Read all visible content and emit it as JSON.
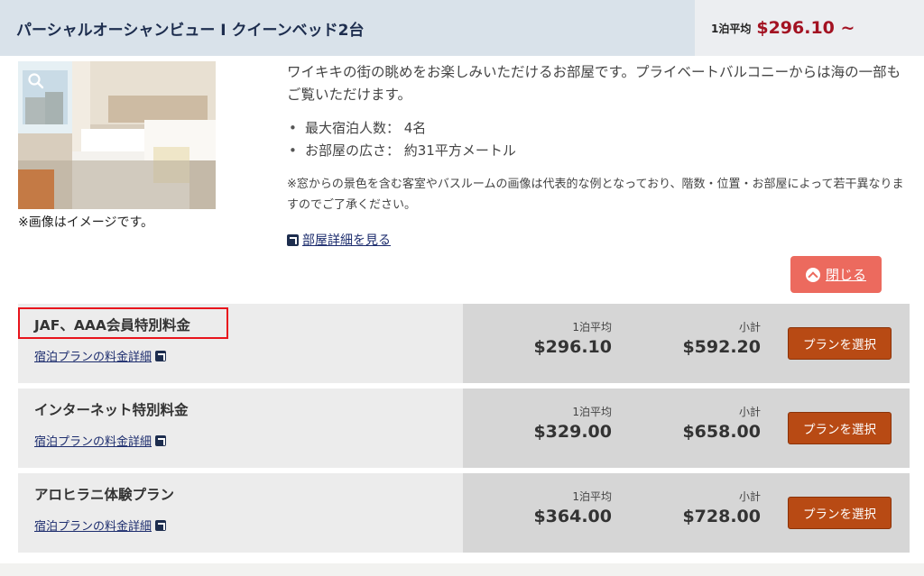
{
  "room": {
    "title": "パーシャルオーシャンビュー I クイーンベッド2台",
    "avg_label": "1泊平均",
    "avg_price": "$296.10 ~",
    "photo_note": "※画像はイメージです。",
    "description": "ワイキキの街の眺めをお楽しみいただけるお部屋です。プライベートバルコニーからは海の一部もご覧いただけます。",
    "specs": [
      "最大宿泊人数： 4名",
      "お部屋の広さ： 約31平方メートル"
    ],
    "note": "※窓からの景色を含む客室やバスルームの画像は代表的な例となっており、階数・位置・お部屋によって若干異なりますのでご了承ください。",
    "detail_link": "部屋詳細を見る",
    "close_label": "閉じる"
  },
  "plans": [
    {
      "name": "JAF、AAA会員特別料金",
      "link": "宿泊プランの料金詳細",
      "avg_label": "1泊平均",
      "avg": "$296.10",
      "subtotal_label": "小計",
      "subtotal": "$592.20",
      "button": "プランを選択",
      "highlighted": true
    },
    {
      "name": "インターネット特別料金",
      "link": "宿泊プランの料金詳細",
      "avg_label": "1泊平均",
      "avg": "$329.00",
      "subtotal_label": "小計",
      "subtotal": "$658.00",
      "button": "プランを選択",
      "highlighted": false
    },
    {
      "name": "アロヒラニ体験プラン",
      "link": "宿泊プランの料金詳細",
      "avg_label": "1泊平均",
      "avg": "$364.00",
      "subtotal_label": "小計",
      "subtotal": "$728.00",
      "button": "プランを選択",
      "highlighted": false
    }
  ],
  "colors": {
    "header_bg": "#d9e2ea",
    "price_red": "#a31222",
    "close_button": "#ec6a5e",
    "select_button": "#b84a14",
    "highlight_border": "#e8141c"
  },
  "icons": {
    "zoom": "magnifier-icon",
    "external": "external-link-icon",
    "close": "chevron-up-circle-icon"
  }
}
